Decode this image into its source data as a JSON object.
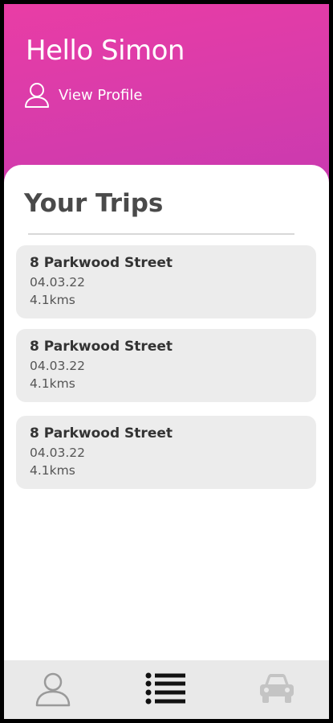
{
  "header": {
    "greeting": "Hello Simon",
    "profile_link": "View Profile",
    "profile_icon": "user-outline-icon"
  },
  "trips": {
    "title": "Your Trips",
    "items": [
      {
        "address": "8 Parkwood Street",
        "date": "04.03.22",
        "distance": "4.1kms"
      },
      {
        "address": "8 Parkwood Street",
        "date": "04.03.22",
        "distance": "4.1kms"
      },
      {
        "address": "8 Parkwood Street",
        "date": "04.03.22",
        "distance": "4.1kms"
      }
    ]
  },
  "tabbar": {
    "tabs": [
      {
        "icon": "user-icon",
        "active": false
      },
      {
        "icon": "list-icon",
        "active": true
      },
      {
        "icon": "car-icon",
        "active": false
      }
    ]
  },
  "colors": {
    "header_gradient_start": "#e93da5",
    "header_gradient_end": "#c93ab0",
    "card_background": "#ececec",
    "tabbar_background": "#e9e9e9"
  }
}
